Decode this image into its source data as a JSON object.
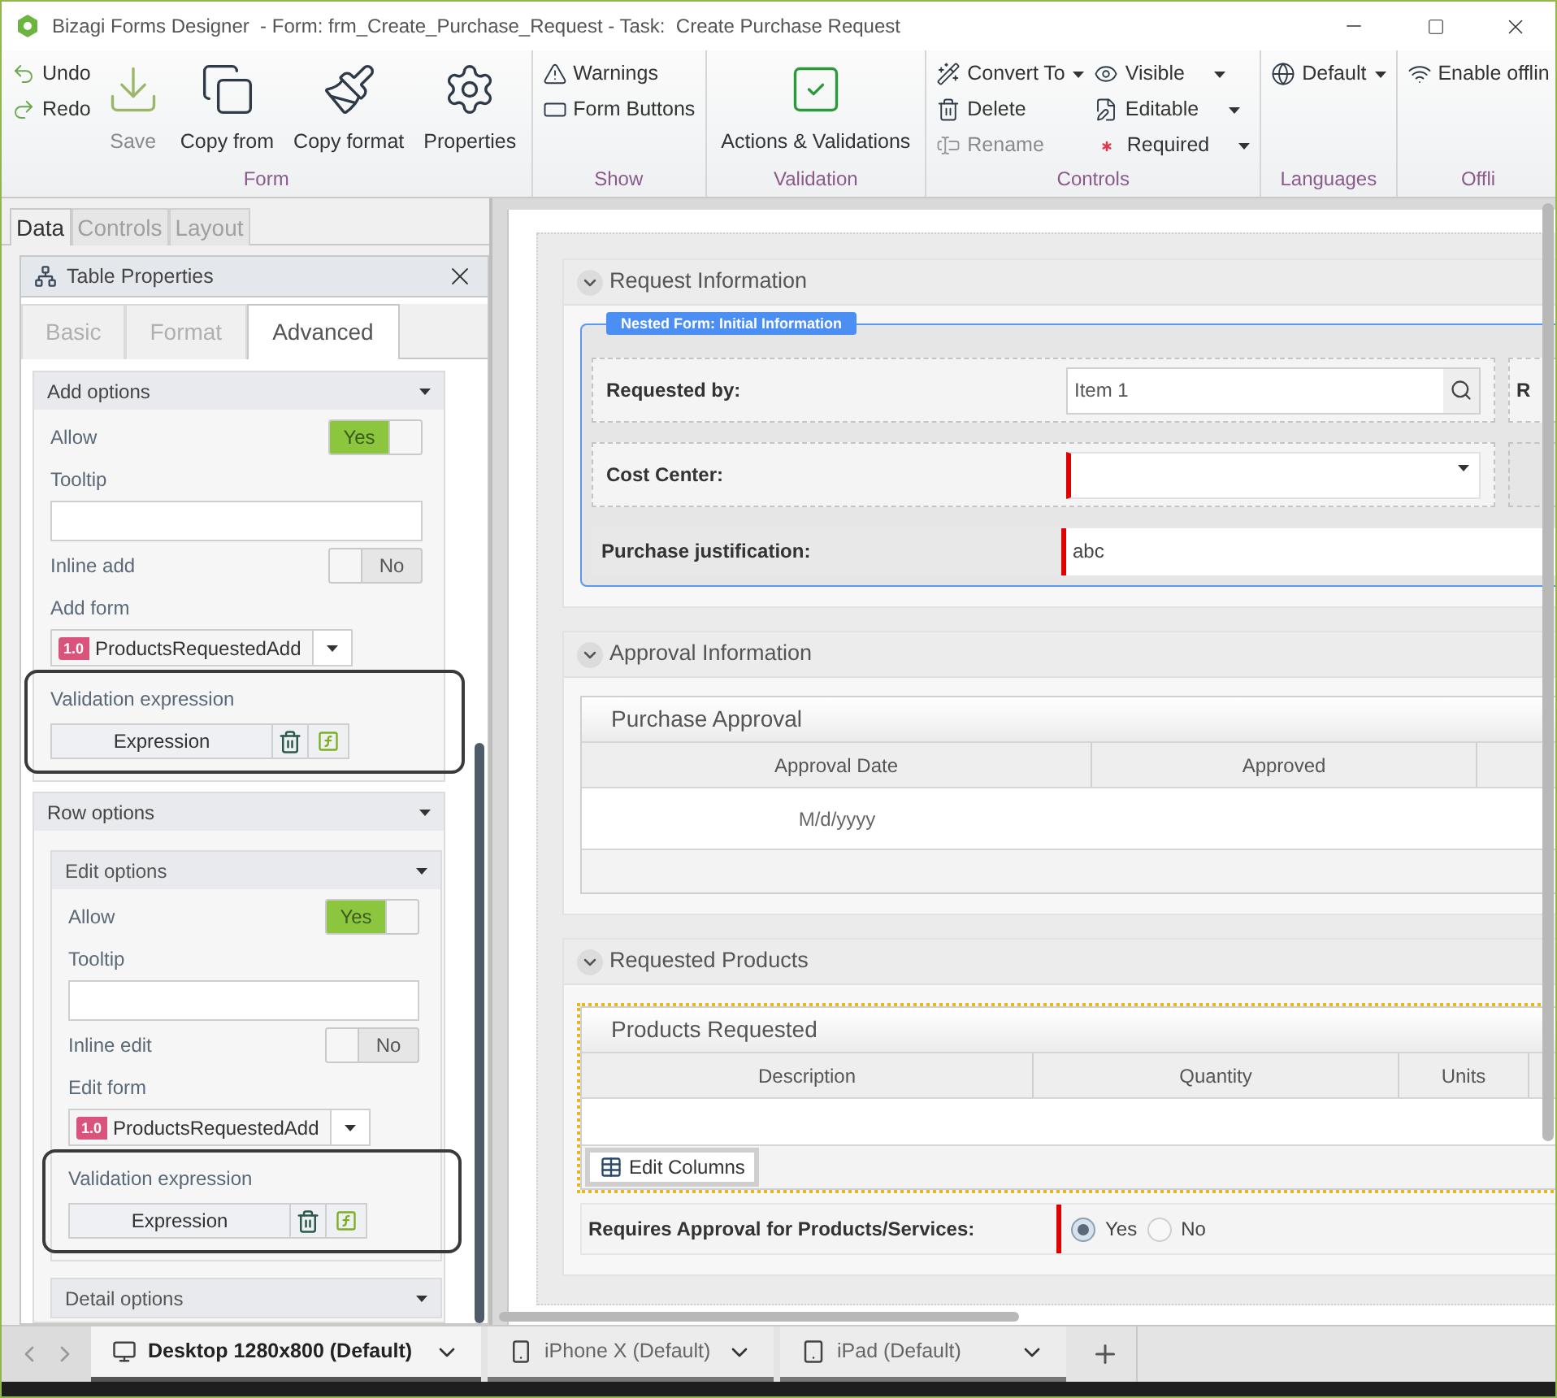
{
  "window": {
    "title": "Bizagi Forms Designer  - Form: frm_Create_Purchase_Request - Task:  Create Purchase Request"
  },
  "ribbon": {
    "groups": [
      {
        "label": "Form",
        "columns": [
          {
            "kind": "stack",
            "buttons": [
              {
                "label": "Undo",
                "disabled": false,
                "dropdown": false
              },
              {
                "label": "Redo",
                "disabled": false,
                "dropdown": false
              }
            ]
          },
          {
            "kind": "large",
            "buttons": [
              {
                "label": "Save",
                "disabled": true,
                "dropdown": false
              }
            ]
          },
          {
            "kind": "large",
            "buttons": [
              {
                "label": "Copy from",
                "disabled": false,
                "dropdown": false
              }
            ]
          },
          {
            "kind": "large",
            "buttons": [
              {
                "label": "Copy format",
                "disabled": false,
                "dropdown": false
              }
            ]
          },
          {
            "kind": "large",
            "buttons": [
              {
                "label": "Properties",
                "disabled": false,
                "dropdown": false
              }
            ]
          }
        ]
      },
      {
        "label": "Show",
        "columns": [
          {
            "kind": "stack",
            "buttons": [
              {
                "label": "Warnings",
                "disabled": false,
                "dropdown": false
              },
              {
                "label": "Form Buttons",
                "disabled": false,
                "dropdown": false
              }
            ]
          }
        ]
      },
      {
        "label": "Validation",
        "columns": [
          {
            "kind": "large",
            "buttons": [
              {
                "label": "Actions & Validations",
                "disabled": false,
                "dropdown": false
              }
            ]
          }
        ]
      },
      {
        "label": "Controls",
        "columns": [
          {
            "kind": "stack",
            "buttons": [
              {
                "label": "Convert To",
                "disabled": false,
                "dropdown": true
              },
              {
                "label": "Delete",
                "disabled": false,
                "dropdown": false
              },
              {
                "label": "Rename",
                "disabled": true,
                "dropdown": false
              }
            ]
          },
          {
            "kind": "stack",
            "buttons": [
              {
                "label": "Visible",
                "disabled": false,
                "dropdown": true
              },
              {
                "label": "Editable",
                "disabled": false,
                "dropdown": true
              },
              {
                "label": "Required",
                "disabled": false,
                "dropdown": true
              }
            ]
          }
        ]
      },
      {
        "label": "Languages",
        "columns": [
          {
            "kind": "stack",
            "buttons": [
              {
                "label": "Default",
                "disabled": false,
                "dropdown": true
              }
            ]
          }
        ]
      },
      {
        "label": "Offli",
        "columns": [
          {
            "kind": "stack",
            "buttons": [
              {
                "label": "Enable offlin",
                "disabled": false,
                "dropdown": false
              }
            ]
          }
        ]
      }
    ]
  },
  "side_tabs": [
    {
      "label": "Data",
      "selected": true
    },
    {
      "label": "Controls",
      "selected": false
    },
    {
      "label": "Layout",
      "selected": false
    }
  ],
  "properties": {
    "title": "Table Properties",
    "tabs": [
      {
        "label": "Basic",
        "selected": false
      },
      {
        "label": "Format",
        "selected": false
      },
      {
        "label": "Advanced",
        "selected": true
      }
    ],
    "sections": [
      {
        "title": "Add options",
        "fields": [
          {
            "kind": "toggle",
            "label": "Allow",
            "on": true,
            "text": "Yes"
          },
          {
            "kind": "text",
            "label": "Tooltip"
          },
          {
            "kind": "toggle",
            "label": "Inline add",
            "on": false,
            "text": "No"
          },
          {
            "kind": "form",
            "label": "Add form",
            "version": "1.0",
            "value": "ProductsRequestedAdd"
          },
          {
            "kind": "expression",
            "label": "Validation expression",
            "button": "Expression",
            "highlighted": true
          }
        ]
      },
      {
        "title": "Row options",
        "subsections": [
          {
            "title": "Edit options",
            "fields": [
              {
                "kind": "toggle",
                "label": "Allow",
                "on": true,
                "text": "Yes"
              },
              {
                "kind": "text",
                "label": "Tooltip"
              },
              {
                "kind": "toggle",
                "label": "Inline edit",
                "on": false,
                "text": "No"
              },
              {
                "kind": "form",
                "label": "Edit form",
                "version": "1.0",
                "value": "ProductsRequestedAdd"
              },
              {
                "kind": "expression",
                "label": "Validation expression",
                "button": "Expression",
                "highlighted": true
              }
            ]
          },
          {
            "title": "Detail options"
          }
        ]
      }
    ]
  },
  "form": {
    "sections": [
      {
        "title": "Request Information",
        "nested_form": {
          "label": "Nested Form: Initial Information",
          "rows": [
            {
              "kind": "search",
              "label": "Requested by:",
              "value": "Item 1",
              "next_label": "R"
            },
            {
              "kind": "dropdown",
              "label": "Cost Center:",
              "required": true
            },
            {
              "kind": "text",
              "label": "Purchase justification:",
              "value": "abc",
              "required": true
            }
          ]
        }
      },
      {
        "title": "Approval Information",
        "table": {
          "title": "Purchase Approval",
          "selected": false,
          "columns": [
            "Approval Date",
            "Approved"
          ],
          "rows": [
            [
              "M/d/yyyy"
            ]
          ]
        }
      },
      {
        "title": "Requested Products",
        "table": {
          "title": "Products Requested",
          "selected": true,
          "columns": [
            "Description",
            "Quantity",
            "Units"
          ],
          "edit_button": "Edit Columns"
        },
        "radio": {
          "label": "Requires Approval for Products/Services:",
          "required": true,
          "options": [
            {
              "label": "Yes",
              "selected": true
            },
            {
              "label": "No",
              "selected": false
            }
          ]
        }
      }
    ]
  },
  "devices": [
    {
      "label": "Desktop 1280x800 (Default)",
      "selected": true
    },
    {
      "label": "iPhone X (Default)",
      "selected": false
    },
    {
      "label": "iPad (Default)",
      "selected": false
    }
  ]
}
